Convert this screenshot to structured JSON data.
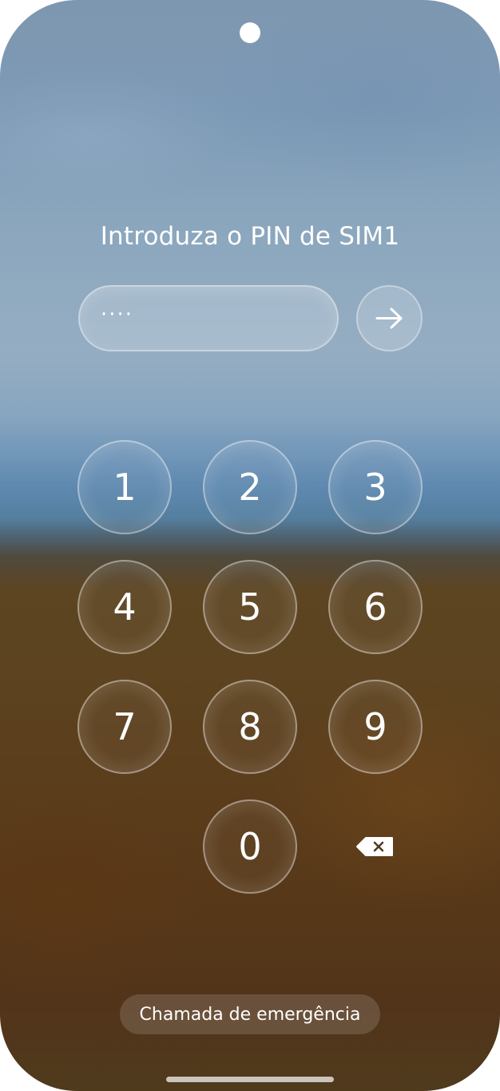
{
  "lock": {
    "title": "Introduza o PIN de SIM1",
    "pin_masked": "····",
    "enter_icon": "arrow-right-icon",
    "backspace_icon": "backspace-icon",
    "emergency_label": "Chamada de emergência"
  },
  "keypad": {
    "k1": "1",
    "k2": "2",
    "k3": "3",
    "k4": "4",
    "k5": "5",
    "k6": "6",
    "k7": "7",
    "k8": "8",
    "k9": "9",
    "k0": "0"
  },
  "colors": {
    "text": "#ffffff",
    "sky": "#7d9ab6",
    "ground": "#5b3d1c"
  }
}
